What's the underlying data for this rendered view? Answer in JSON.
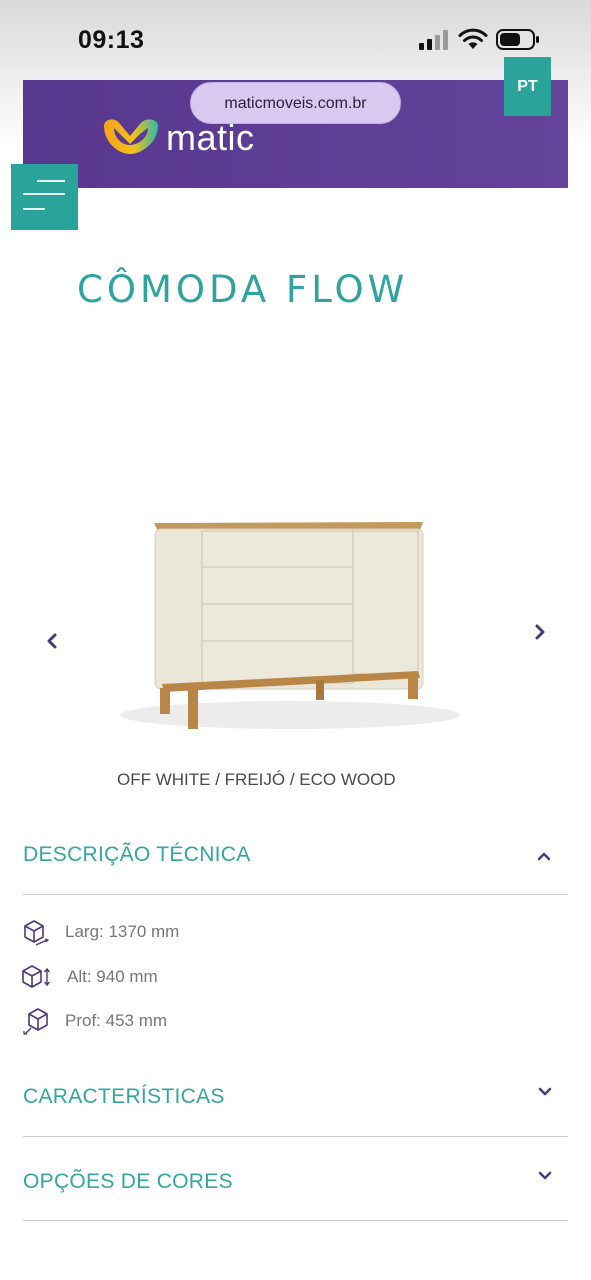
{
  "status_bar": {
    "time": "09:13"
  },
  "browser": {
    "url": "maticmoveis.com.br"
  },
  "header": {
    "logo_text": "matic",
    "lang_label": "PT"
  },
  "page": {
    "title": "CÔMODA FLOW"
  },
  "product": {
    "variant": "OFF WHITE / FREIJÓ / ECO WOOD"
  },
  "sections": {
    "technical": {
      "title": "DESCRIÇÃO TÉCNICA",
      "expanded": true
    },
    "features": {
      "title": "CARACTERÍSTICAS",
      "expanded": false
    },
    "colors": {
      "title": "OPÇÕES DE CORES",
      "expanded": false
    }
  },
  "specs": {
    "width": "Larg: 1370 mm",
    "height": "Alt: 940 mm",
    "depth": "Prof: 453 mm"
  },
  "colors": {
    "brand_purple": "#5f3e96",
    "brand_teal": "#2aa39a",
    "accent_text": "#33a6a0",
    "arrow": "#4a3a7a"
  }
}
